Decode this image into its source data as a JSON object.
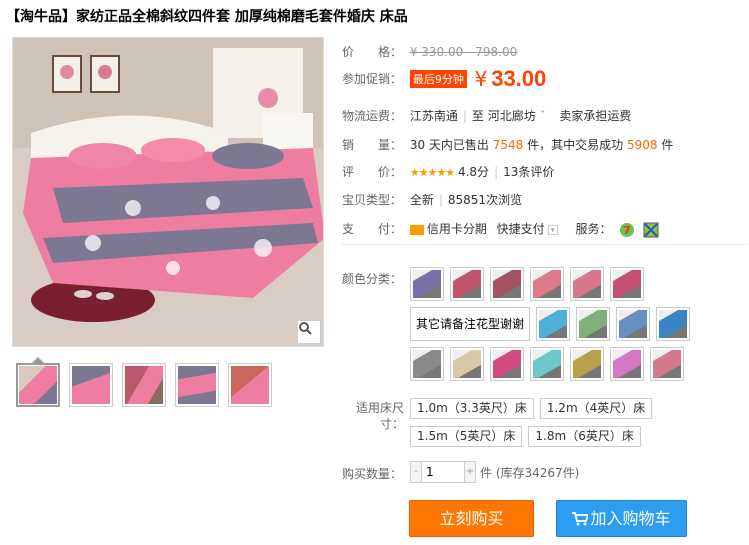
{
  "title": "【淘牛品】家纺正品全棉斜纹四件套 加厚纯棉磨毛套件婚庆 床品",
  "price": {
    "label": "价　　格：",
    "original": "¥ 330.00 - 798.00"
  },
  "promo": {
    "label": "参加促销：",
    "badge": "最后9分钟",
    "yen": "¥",
    "price": "33.00"
  },
  "shipping": {
    "label": "物流运费：",
    "from": "江苏南通",
    "sep": "至",
    "to": "河北廊坊",
    "arrow": "ˇ",
    "fee": "卖家承担运费"
  },
  "sales": {
    "label": "销　　量：",
    "prefix": "30 天内已售出",
    "sold": "7548",
    "mid": "件，其中交易成功",
    "success": "5908",
    "suffix": "件"
  },
  "rating": {
    "label": "评　　价：",
    "stars": "★★★★★",
    "score": "4.8分",
    "reviews": "13条评价"
  },
  "type": {
    "label": "宝贝类型：",
    "value": "全新",
    "views": "85851次浏览"
  },
  "payment": {
    "label": "支　　付：",
    "card": "信用卡分期",
    "quick": "快捷支付",
    "service_label": "服务："
  },
  "color_label": "颜色分类：",
  "color_text_option": "其它请备注花型谢谢",
  "swatch_colors": [
    [
      "#7a6fa6",
      "#c0546a",
      "#a35360",
      "#e07a88",
      "#d9778a",
      "#c44f70"
    ],
    [
      "#4fb0d6",
      "#7fb07a",
      "#6a8ec0",
      "#3a84c5"
    ],
    [
      "#8a8a8a",
      "#d9c8a5",
      "#d44a7e",
      "#6fc7c9",
      "#b8a04a",
      "#d478c4",
      "#d27a8c"
    ]
  ],
  "size_label": "适用床尺寸：",
  "sizes": [
    [
      "1.0m（3.3英尺）床",
      "1.2m（4英尺）床"
    ],
    [
      "1.5m（5英尺）床",
      "1.8m（6英尺）床"
    ]
  ],
  "qty": {
    "label": "购买数量：",
    "value": "1",
    "minus": "-",
    "plus": "+",
    "stock": "件 (库存34267件)"
  },
  "buttons": {
    "buy": "立刻购买",
    "cart": "加入购物车"
  }
}
